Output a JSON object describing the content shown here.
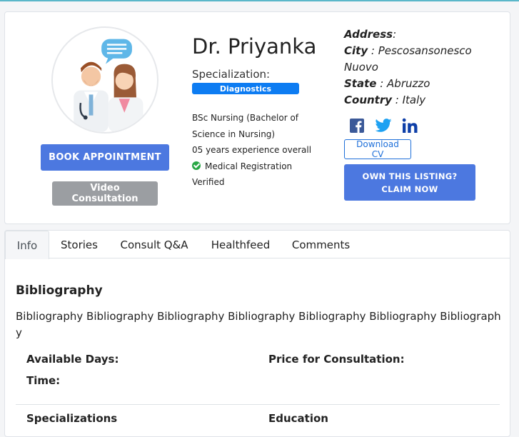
{
  "profile": {
    "name": "Dr. Priyanka",
    "specialization_label": "Specialization:",
    "specialization": "Diagnostics",
    "qualification_line1": "BSc Nursing (Bachelor of",
    "qualification_line2": "Science in Nursing)",
    "experience": "05 years experience overall",
    "verified_line1": "Medical Registration",
    "verified_line2": "Verified",
    "book_button": "BOOK APPOINTMENT",
    "video_button": "Video Consultation"
  },
  "address": {
    "heading": "Address",
    "city_label": "City",
    "city_line1": "Pescosansonesco",
    "city_line2": "Nuovo",
    "state_label": "State",
    "state": "Abruzzo",
    "country_label": "Country",
    "country": "Italy"
  },
  "social": {
    "icons": [
      "facebook-icon",
      "twitter-icon",
      "linkedin-icon"
    ],
    "facebook_color": "#3b5998",
    "twitter_color": "#1da1f2",
    "linkedin_color": "#0e3fa8"
  },
  "actions": {
    "download_cv": "Download CV",
    "claim_line1": "OWN THIS LISTING?",
    "claim_line2": "CLAIM NOW"
  },
  "tabs": [
    {
      "label": "Info",
      "active": true
    },
    {
      "label": "Stories",
      "active": false
    },
    {
      "label": "Consult Q&A",
      "active": false
    },
    {
      "label": "Healthfeed",
      "active": false
    },
    {
      "label": "Comments",
      "active": false
    }
  ],
  "info": {
    "bibliography_title": "Bibliography",
    "bibliography_text": "Bibliography Bibliography Bibliography Bibliography Bibliography Bibliography Bibliography",
    "available_days_label": "Available Days:",
    "price_label": "Price for Consultation:",
    "time_label": "Time:",
    "specializations_label": "Specializations",
    "education_label": "Education"
  },
  "colors": {
    "primary_button": "#4c78e0",
    "secondary_button": "#9b9ea2",
    "badge": "#0d7cf2",
    "verified": "#28a745"
  }
}
